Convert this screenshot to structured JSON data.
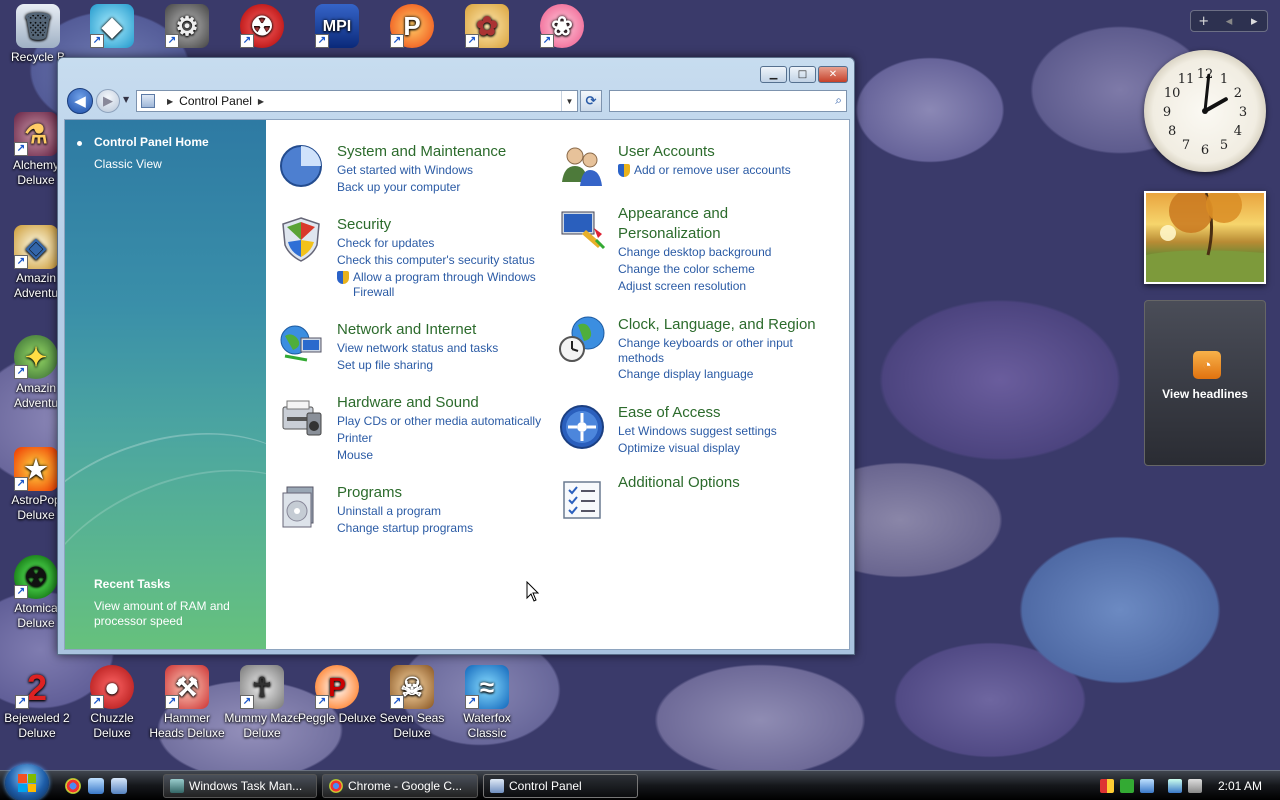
{
  "desktop_icons": [
    {
      "name": "recycle-bin-icon",
      "label": "Recycle B"
    },
    {
      "name": "gem-app-icon",
      "label": ""
    },
    {
      "name": "gear-app-icon",
      "label": ""
    },
    {
      "name": "radiation-app-icon",
      "label": ""
    },
    {
      "name": "mpi-app-icon",
      "label": ""
    },
    {
      "name": "p-app-icon",
      "label": ""
    },
    {
      "name": "fairy-app-icon",
      "label": ""
    },
    {
      "name": "flower-app-icon",
      "label": ""
    },
    {
      "name": "alchemy-icon",
      "label": "Alchemy Deluxe"
    },
    {
      "name": "amazing-adventures-icon",
      "label": "Amazin Adventu"
    },
    {
      "name": "amazing-adventures-2-icon",
      "label": "Amazin Adventu"
    },
    {
      "name": "astropop-icon",
      "label": "AstroPop Deluxe"
    },
    {
      "name": "atomica-icon",
      "label": "Atomica Deluxe"
    },
    {
      "name": "bejeweled-icon",
      "label": "Bejeweled 2 Deluxe"
    },
    {
      "name": "chuzzle-icon",
      "label": "Chuzzle Deluxe"
    },
    {
      "name": "hammer-heads-icon",
      "label": "Hammer Heads Deluxe"
    },
    {
      "name": "mummy-maze-icon",
      "label": "Mummy Maze Deluxe"
    },
    {
      "name": "peggle-icon",
      "label": "Peggle Deluxe"
    },
    {
      "name": "seven-seas-icon",
      "label": "Seven Seas Deluxe"
    },
    {
      "name": "waterfox-icon",
      "label": "Waterfox Classic"
    }
  ],
  "window": {
    "address_crumb": "Control Panel",
    "search_placeholder": "",
    "min_glyph": "▁",
    "max_glyph": "□",
    "close_glyph": "✕",
    "back_glyph": "◀",
    "fwd_glyph": "▶",
    "refresh_glyph": "⟳",
    "search_glyph": "⌕"
  },
  "left_pane": {
    "home": "Control Panel Home",
    "classic": "Classic View",
    "recent_title": "Recent Tasks",
    "recent_task": "View amount of RAM and processor speed"
  },
  "categories": {
    "system": {
      "title": "System and Maintenance",
      "links": [
        "Get started with Windows",
        "Back up your computer"
      ]
    },
    "security": {
      "title": "Security",
      "links": [
        "Check for updates",
        "Check this computer's security status"
      ],
      "shield_link": "Allow a program through Windows Firewall"
    },
    "network": {
      "title": "Network and Internet",
      "links": [
        "View network status and tasks",
        "Set up file sharing"
      ]
    },
    "hardware": {
      "title": "Hardware and Sound",
      "links": [
        "Play CDs or other media automatically",
        "Printer",
        "Mouse"
      ]
    },
    "programs": {
      "title": "Programs",
      "links": [
        "Uninstall a program",
        "Change startup programs"
      ]
    },
    "users": {
      "title": "User Accounts",
      "shield_link": "Add or remove user accounts"
    },
    "appearance": {
      "title": "Appearance and Personalization",
      "links": [
        "Change desktop background",
        "Change the color scheme",
        "Adjust screen resolution"
      ]
    },
    "clock": {
      "title": "Clock, Language, and Region",
      "links": [
        "Change keyboards or other input methods",
        "Change display language"
      ]
    },
    "ease": {
      "title": "Ease of Access",
      "links": [
        "Let Windows suggest settings",
        "Optimize visual display"
      ]
    },
    "additional": {
      "title": "Additional Options"
    }
  },
  "gadgets": {
    "toolbar_add": "+",
    "toolbar_prev": "◂",
    "toolbar_next": "▸",
    "feed_label": "View headlines",
    "clock_time": "2:01",
    "clock_numerals": [
      "12",
      "1",
      "2",
      "3",
      "4",
      "5",
      "6",
      "7",
      "8",
      "9",
      "10",
      "11"
    ]
  },
  "taskbar": {
    "tasks": [
      "Windows Task Man...",
      "Chrome - Google C...",
      "Control Panel"
    ],
    "active_index": 2,
    "time": "2:01 AM"
  },
  "colors": {
    "category_title": "#2c6b2c",
    "link": "#2b5ba5",
    "left_pane_top": "#2e7aa3",
    "left_pane_bottom": "#66c17c"
  }
}
